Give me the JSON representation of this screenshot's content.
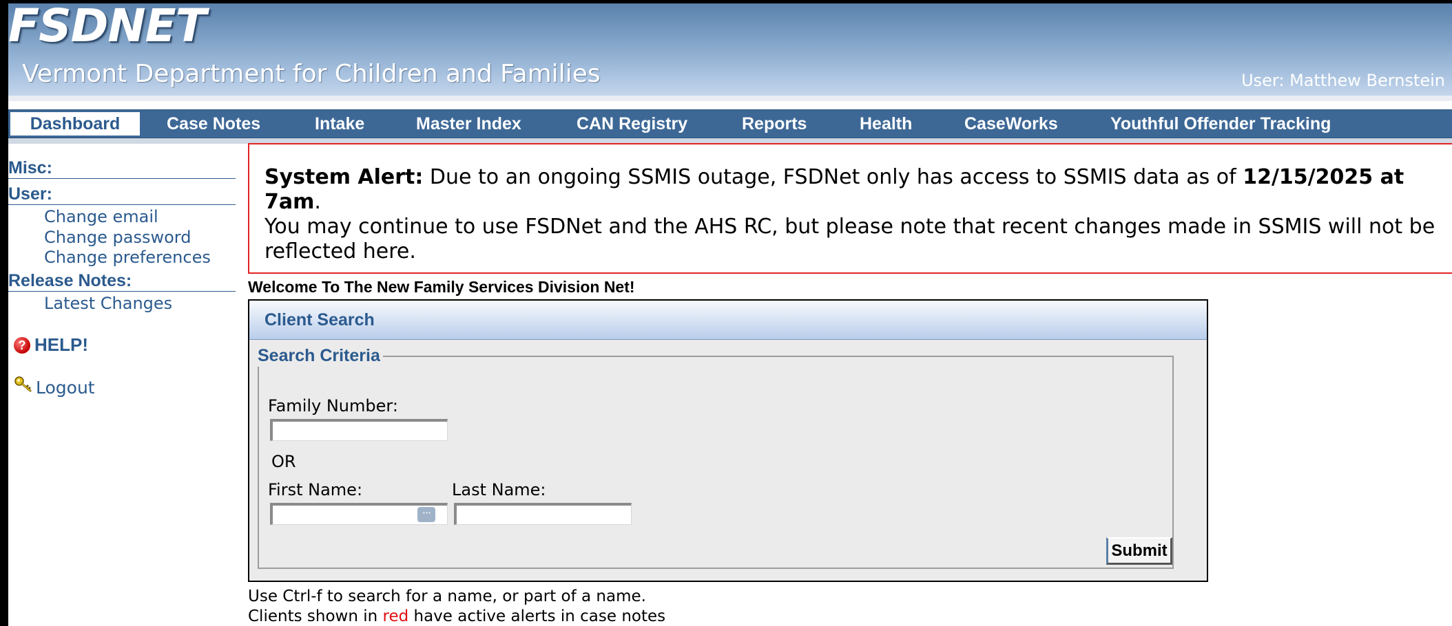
{
  "header": {
    "logo": "FSDNET",
    "department": "Vermont Department for Children and Families",
    "user_label": "User:",
    "user_name": "Matthew Bernstein"
  },
  "nav": {
    "items": [
      {
        "label": "Dashboard",
        "active": true
      },
      {
        "label": "Case Notes"
      },
      {
        "label": "Intake"
      },
      {
        "label": "Master Index"
      },
      {
        "label": "CAN Registry"
      },
      {
        "label": "Reports"
      },
      {
        "label": "Health"
      },
      {
        "label": "CaseWorks"
      },
      {
        "label": "Youthful Offender Tracking"
      }
    ]
  },
  "sidebar": {
    "misc_heading": "Misc:",
    "user_heading": "User:",
    "user_links": [
      "Change email",
      "Change password",
      "Change preferences"
    ],
    "release_heading": "Release Notes:",
    "release_links": [
      "Latest Changes"
    ],
    "help": "HELP!",
    "logout": "Logout",
    "icons": {
      "help": "help-icon",
      "logout": "key-icon"
    }
  },
  "alert": {
    "label": "System Alert:",
    "text1": " Due to an ongoing SSMIS outage, FSDNet only has access to SSMIS data as of ",
    "date": "12/15/2025 at 7am",
    "period": ".",
    "text2": "You may continue to use FSDNet and the AHS RC, but please note that recent changes made in SSMIS will not be reflected here.",
    "border_color": "#e32222"
  },
  "welcome": "Welcome To The New Family Services Division Net!",
  "client_search": {
    "title": "Client Search",
    "legend": "Search Criteria",
    "family_number_label": "Family Number:",
    "family_number_value": "",
    "or_text": "OR",
    "first_name_label": "First Name:",
    "first_name_value": "",
    "last_name_label": "Last Name:",
    "last_name_value": "",
    "submit_label": "Submit"
  },
  "footer": {
    "line1": "Use Ctrl-f to search for a name, or part of a name.",
    "line2_before": "Clients shown in ",
    "line2_red": "red",
    "line2_after": " have active alerts in case notes"
  },
  "colors": {
    "brand_blue": "#3d6896",
    "link_blue": "#2b5a8e",
    "alert_red": "#e01010"
  }
}
